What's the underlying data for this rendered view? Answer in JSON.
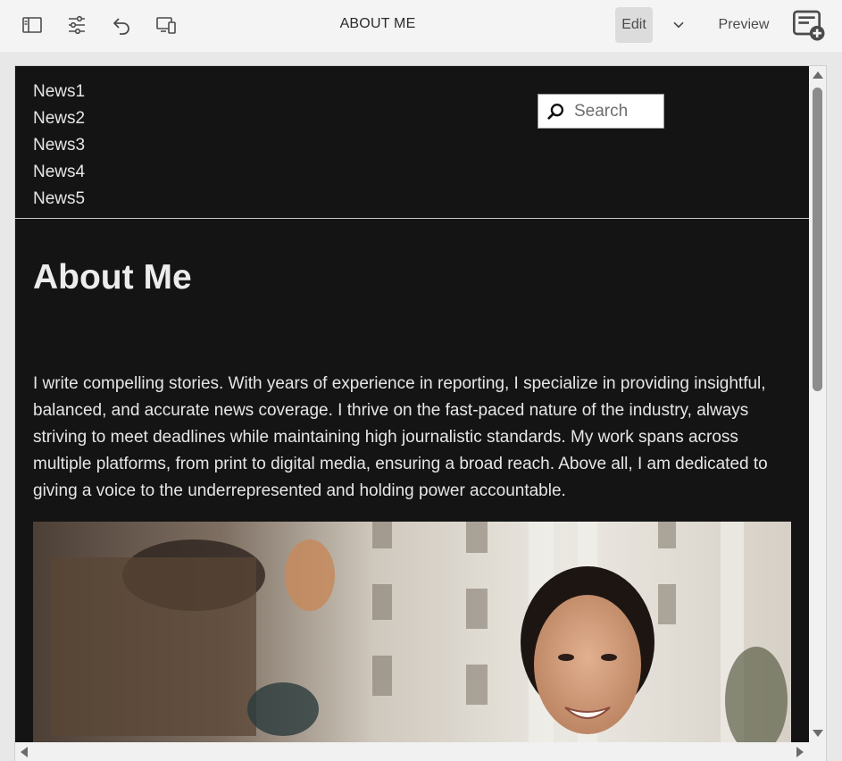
{
  "toolbar": {
    "title": "ABOUT ME",
    "edit_label": "Edit",
    "preview_label": "Preview",
    "icons": [
      "side-panel-icon",
      "properties-icon",
      "undo-icon",
      "emulator-icon",
      "chevron-down-icon",
      "annotations-icon"
    ]
  },
  "site": {
    "nav_items": [
      {
        "label": "News1"
      },
      {
        "label": "News2"
      },
      {
        "label": "News3"
      },
      {
        "label": "News4"
      },
      {
        "label": "News5"
      }
    ],
    "search": {
      "placeholder": "Search"
    }
  },
  "content": {
    "title": "About Me",
    "body": "I write compelling stories. With years of experience in reporting, I specialize in providing insightful, balanced, and accurate news coverage. I thrive on the fast-paced nature of the industry, always striving to meet deadlines while maintaining high journalistic standards. My work spans across multiple platforms, from print to digital media, ensuring a broad reach. Above all, I am dedicated to giving a voice to the underrepresented and holding power accountable."
  },
  "colors": {
    "page_background": "#141414",
    "toolbar_background": "#f4f4f4",
    "edit_active": "#dcdcdc"
  }
}
